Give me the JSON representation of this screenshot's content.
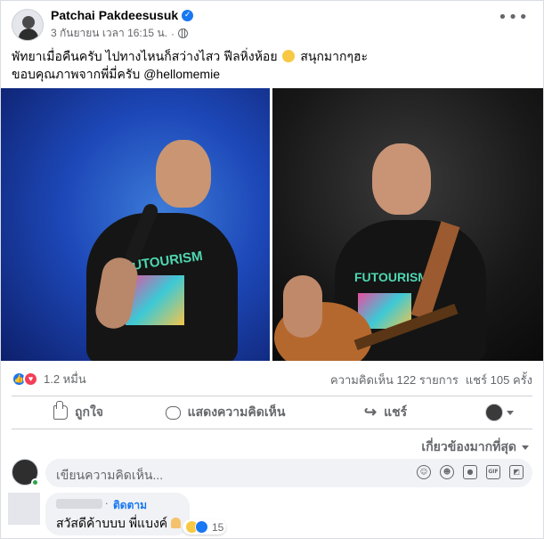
{
  "post": {
    "author": "Patchai Pakdeesusuk",
    "timestamp": "3 กันยายน เวลา 16:15 น.",
    "caption_line1": "พัทยาเมื่อคืนครับ ไปทางไหนก็สว่างไสว ฟีลหิ่งห้อย",
    "caption_line1_tail": "สนุกมากๆฮะ",
    "caption_line2": "ขอบคุณภาพจากพี่มี่ครับ @hellomemie",
    "more_icon": "more-horizontal-icon",
    "privacy_icon": "globe-icon"
  },
  "photos": {
    "left_shirt_text": "FUTOURISM",
    "right_shirt_text": "FUTOURISM"
  },
  "stats": {
    "reaction_count": "1.2 หมื่น",
    "comments": "ความคิดเห็น 122 รายการ",
    "shares": "แชร์ 105 ครั้ง",
    "colors": {
      "like": "#1877f2",
      "love": "#f33e58"
    }
  },
  "actions": {
    "like": "ถูกใจ",
    "comment": "แสดงความคิดเห็น",
    "share": "แชร์"
  },
  "sort": {
    "label": "เกี่ยวข้องมากที่สุด"
  },
  "composer": {
    "placeholder": "เขียนความคิดเห็น...",
    "tools": [
      "profile-sticker-icon",
      "emoji-icon",
      "camera-icon",
      "gif-icon",
      "sticker-icon"
    ],
    "gif_label": "GIF"
  },
  "comment": {
    "follow_label": "ติดตาม",
    "text": "สวัสดีค้าบบบ พี่แบงค์",
    "reaction_count": "15"
  }
}
